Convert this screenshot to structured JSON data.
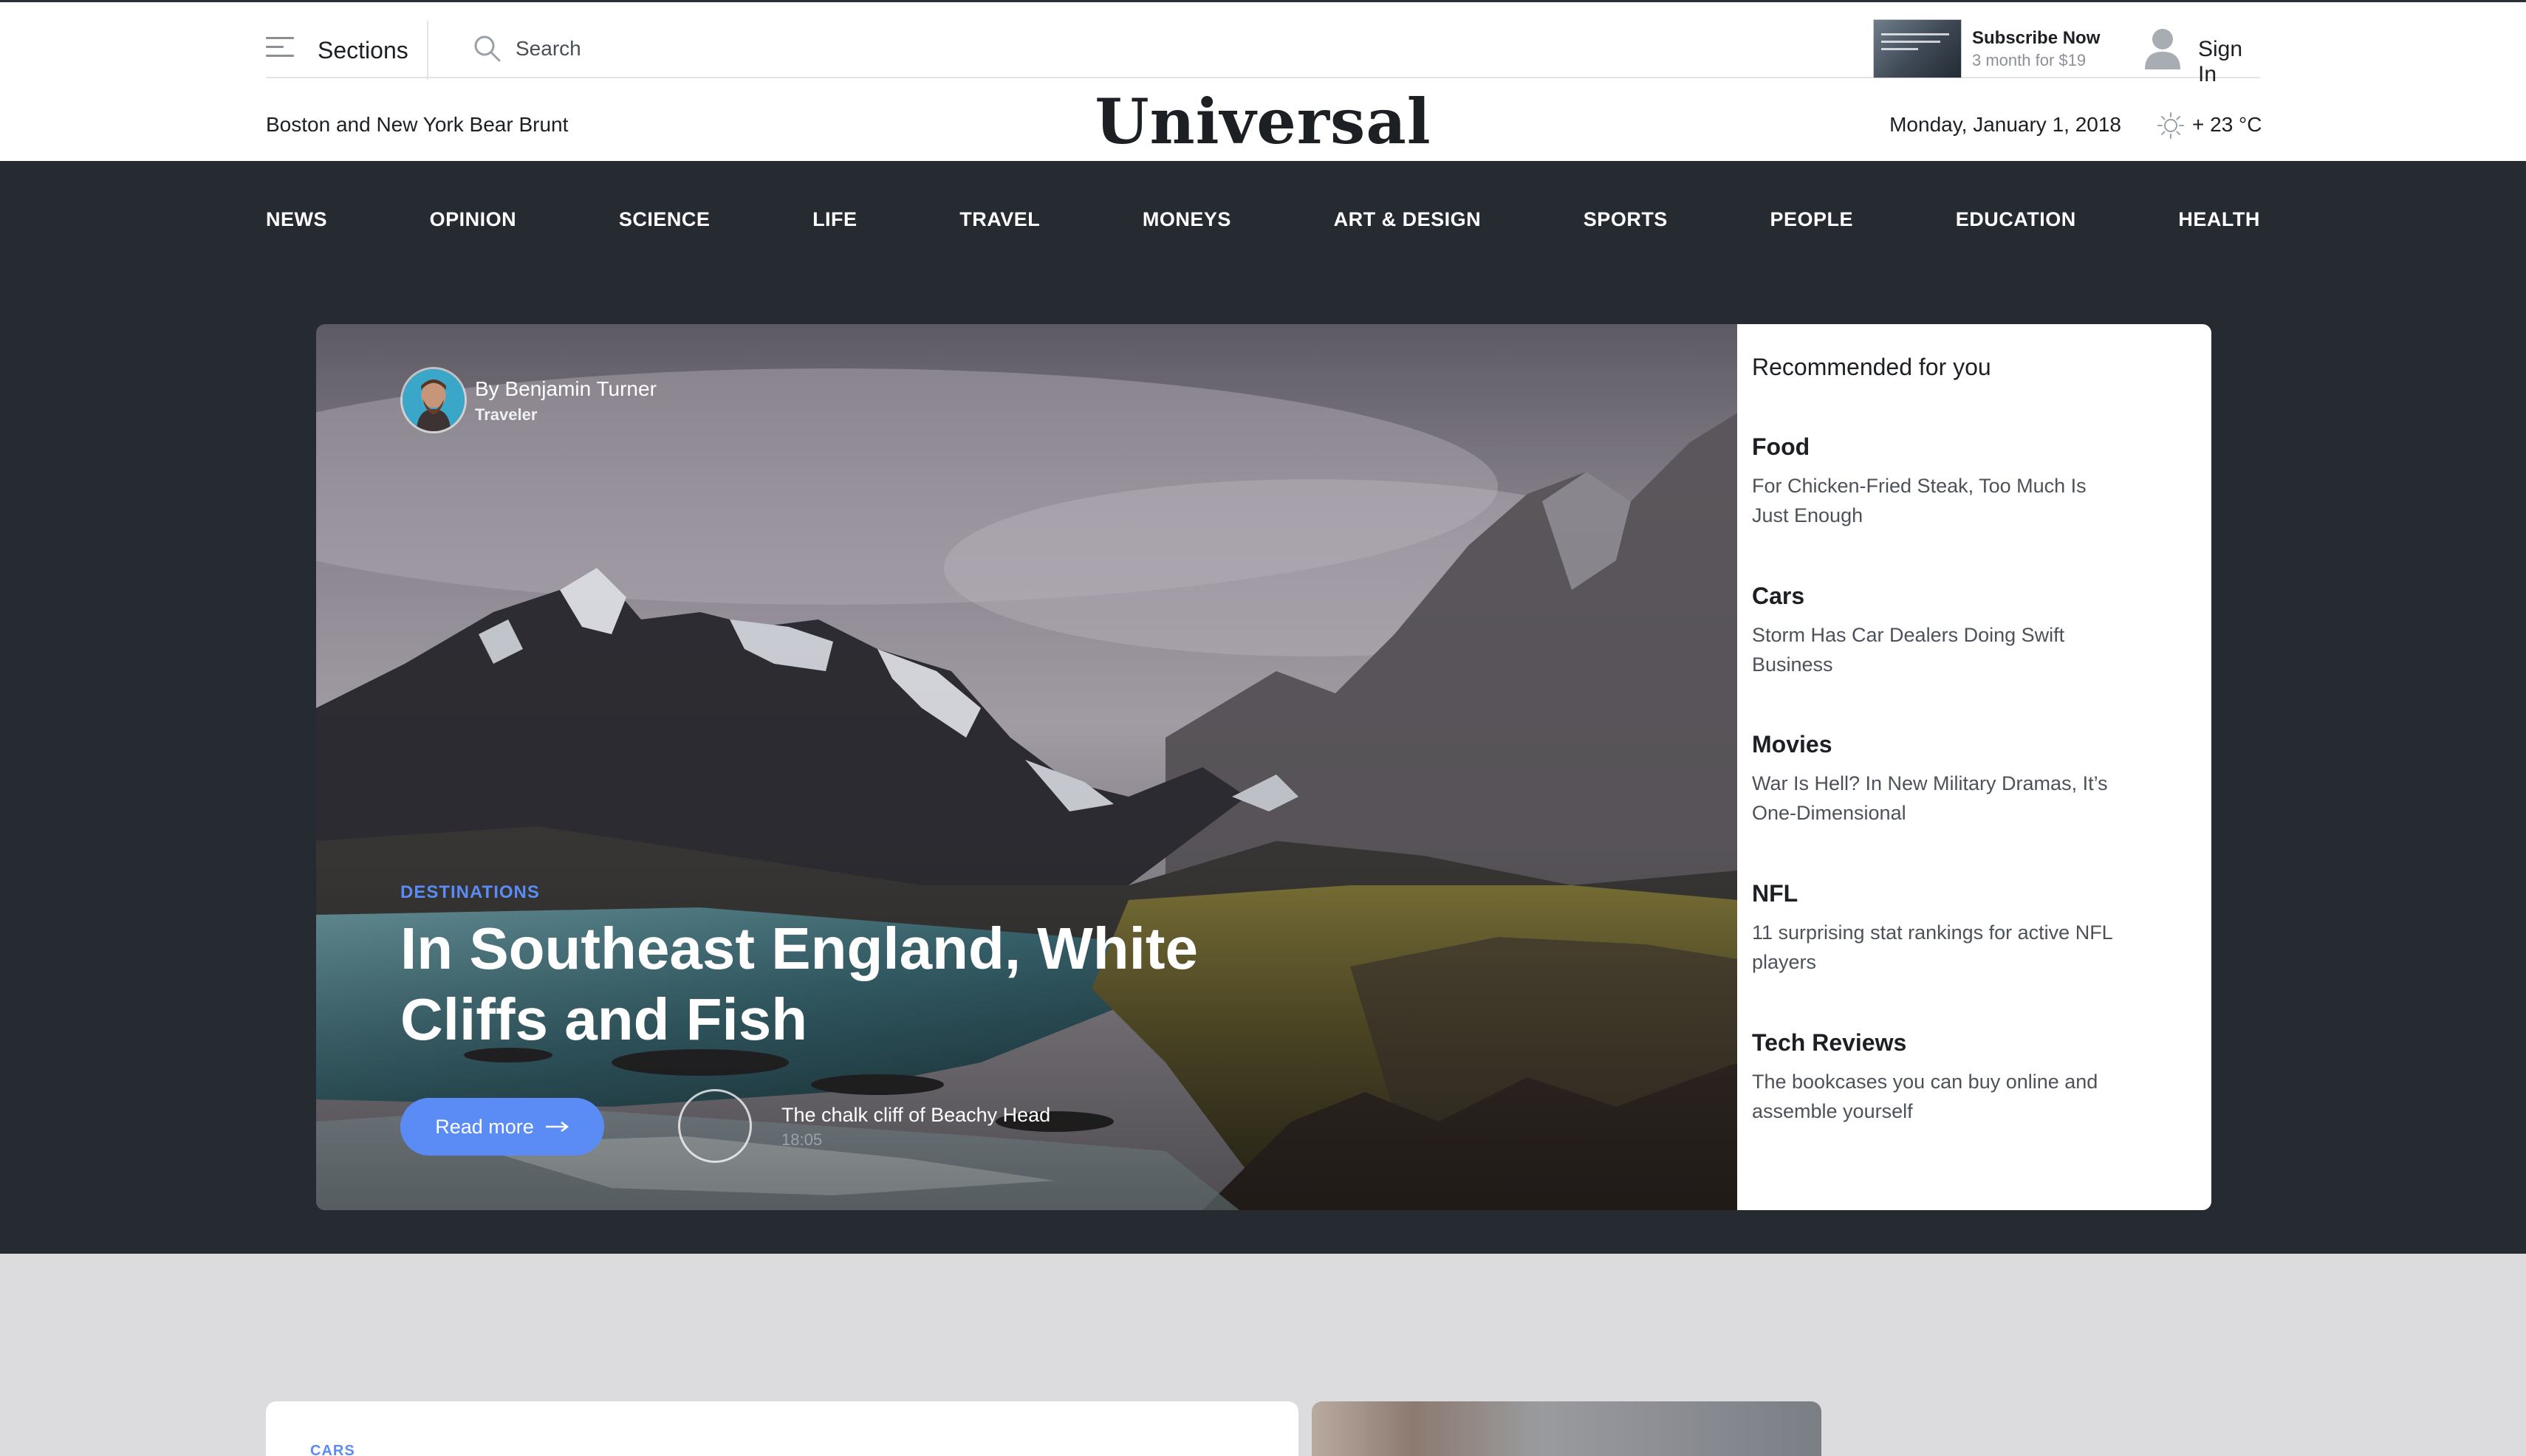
{
  "topbar": {
    "sections_label": "Sections",
    "search_placeholder": "Search",
    "subscribe": {
      "title": "Subscribe Now",
      "price": "3 month for $19"
    },
    "sign_in": "Sign In"
  },
  "masthead": {
    "headline": "Boston and New York Bear Brunt",
    "logo": "Universal",
    "date": "Monday, January 1, 2018",
    "temperature": "+ 23 °C"
  },
  "nav": [
    "NEWS",
    "OPINION",
    "SCIENCE",
    "LIFE",
    "TRAVEL",
    "MONEYS",
    "ART & DESIGN",
    "SPORTS",
    "PEOPLE",
    "EDUCATION",
    "HEALTH"
  ],
  "hero": {
    "author": "By Benjamin Turner",
    "author_role": "Traveler",
    "category": "DESTINATIONS",
    "title": "In Southeast England, White Cliffs and Fish",
    "read_more": "Read more",
    "video_title": "The chalk cliff of Beachy Head",
    "video_time": "18:05"
  },
  "recommended": {
    "heading": "Recommended for you",
    "items": [
      {
        "category": "Food",
        "text": "For Chicken-Fried Steak, Too Much Is Just Enough"
      },
      {
        "category": "Cars",
        "text": "Storm Has Car Dealers Doing Swift Business"
      },
      {
        "category": "Movies",
        "text": "War Is Hell? In New Military Dramas, It’s One-Dimensional"
      },
      {
        "category": "NFL",
        "text": "11 surprising stat rankings for active NFL players"
      },
      {
        "category": "Tech Reviews",
        "text": "The bookcases you can buy online and assemble yourself"
      }
    ]
  },
  "lower": {
    "card_label": "CARS"
  },
  "colors": {
    "accent": "#5b8cf5",
    "dark_bg": "#262a31",
    "page_bg": "#dcdcdf"
  }
}
